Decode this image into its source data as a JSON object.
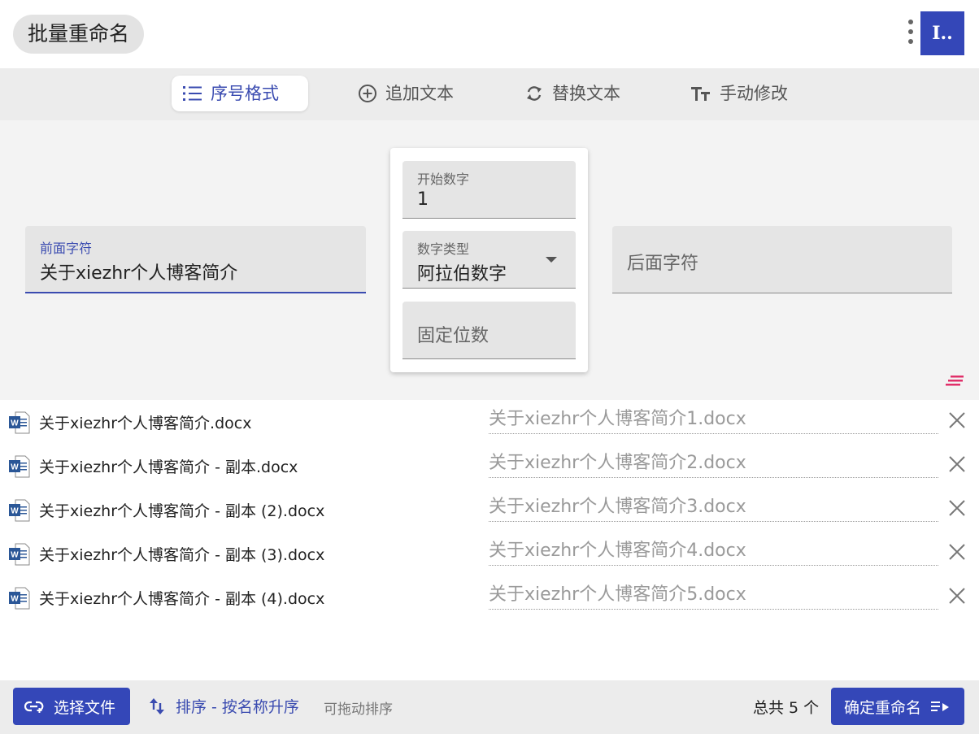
{
  "header": {
    "title": "批量重命名",
    "avatar_text": "I..",
    "menu_icon": "more-vert-icon"
  },
  "tabs": [
    {
      "label": "序号格式",
      "icon": "list-numbered-icon",
      "active": true
    },
    {
      "label": "追加文本",
      "icon": "add-circle-icon",
      "active": false
    },
    {
      "label": "替换文本",
      "icon": "replace-icon",
      "active": false
    },
    {
      "label": "手动修改",
      "icon": "text-size-icon",
      "active": false
    }
  ],
  "config": {
    "prefix": {
      "label": "前面字符",
      "value": "关于xiezhr个人博客简介"
    },
    "start_number": {
      "label": "开始数字",
      "value": "1"
    },
    "number_type": {
      "label": "数字类型",
      "value": "阿拉伯数字"
    },
    "fixed_digits": {
      "placeholder": "固定位数"
    },
    "suffix": {
      "placeholder": "后面字符"
    }
  },
  "files": [
    {
      "original": "关于xiezhr个人博客简介.docx",
      "new_name": "关于xiezhr个人博客简介1.docx"
    },
    {
      "original": "关于xiezhr个人博客简介 - 副本.docx",
      "new_name": "关于xiezhr个人博客简介2.docx"
    },
    {
      "original": "关于xiezhr个人博客简介 - 副本 (2).docx",
      "new_name": "关于xiezhr个人博客简介3.docx"
    },
    {
      "original": "关于xiezhr个人博客简介 - 副本 (3).docx",
      "new_name": "关于xiezhr个人博客简介4.docx"
    },
    {
      "original": "关于xiezhr个人博客简介 - 副本 (4).docx",
      "new_name": "关于xiezhr个人博客简介5.docx"
    }
  ],
  "footer": {
    "select_files": "选择文件",
    "sort_label": "排序 - 按名称升序",
    "drag_hint": "可拖动排序",
    "total": "总共 5 个",
    "confirm": "确定重命名"
  },
  "colors": {
    "primary": "#3447b8",
    "accent_pink": "#e0306a",
    "word_blue": "#2b5797"
  }
}
